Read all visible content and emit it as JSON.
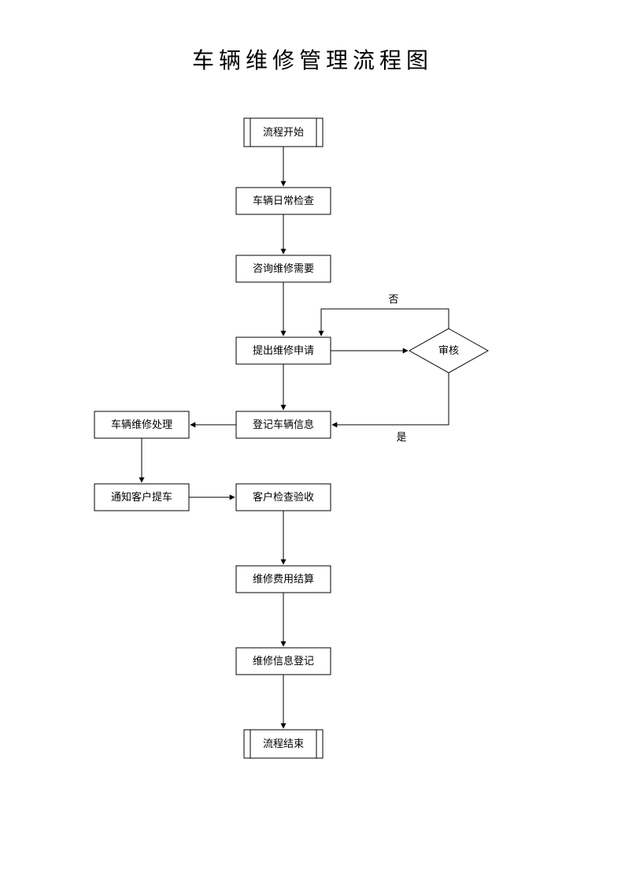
{
  "title": "车辆维修管理流程图",
  "nodes": {
    "start": {
      "label": "流程开始"
    },
    "daily_check": {
      "label": "车辆日常检查"
    },
    "consult": {
      "label": "咨询维修需要"
    },
    "apply": {
      "label": "提出维修申请"
    },
    "audit": {
      "label": "审核"
    },
    "register_info": {
      "label": "登记车辆信息"
    },
    "repair": {
      "label": "车辆维修处理"
    },
    "notify": {
      "label": "通知客户提车"
    },
    "inspect": {
      "label": "客户检查验收"
    },
    "settle": {
      "label": "维修费用结算"
    },
    "log": {
      "label": "维修信息登记"
    },
    "end": {
      "label": "流程结束"
    }
  },
  "edges": {
    "audit_no": {
      "label": "否"
    },
    "audit_yes": {
      "label": "是"
    }
  },
  "chart_data": {
    "type": "flowchart",
    "title": "车辆维修管理流程图",
    "nodes": [
      {
        "id": "start",
        "type": "terminator",
        "label": "流程开始"
      },
      {
        "id": "daily_check",
        "type": "process",
        "label": "车辆日常检查"
      },
      {
        "id": "consult",
        "type": "process",
        "label": "咨询维修需要"
      },
      {
        "id": "apply",
        "type": "process",
        "label": "提出维修申请"
      },
      {
        "id": "audit",
        "type": "decision",
        "label": "审核"
      },
      {
        "id": "register_info",
        "type": "process",
        "label": "登记车辆信息"
      },
      {
        "id": "repair",
        "type": "process",
        "label": "车辆维修处理"
      },
      {
        "id": "notify",
        "type": "process",
        "label": "通知客户提车"
      },
      {
        "id": "inspect",
        "type": "process",
        "label": "客户检查验收"
      },
      {
        "id": "settle",
        "type": "process",
        "label": "维修费用结算"
      },
      {
        "id": "log",
        "type": "process",
        "label": "维修信息登记"
      },
      {
        "id": "end",
        "type": "terminator",
        "label": "流程结束"
      }
    ],
    "edges": [
      {
        "from": "start",
        "to": "daily_check"
      },
      {
        "from": "daily_check",
        "to": "consult"
      },
      {
        "from": "consult",
        "to": "apply"
      },
      {
        "from": "apply",
        "to": "audit"
      },
      {
        "from": "audit",
        "to": "apply",
        "label": "否"
      },
      {
        "from": "audit",
        "to": "register_info",
        "label": "是"
      },
      {
        "from": "apply",
        "to": "register_info"
      },
      {
        "from": "register_info",
        "to": "repair"
      },
      {
        "from": "repair",
        "to": "notify"
      },
      {
        "from": "notify",
        "to": "inspect"
      },
      {
        "from": "inspect",
        "to": "settle"
      },
      {
        "from": "settle",
        "to": "log"
      },
      {
        "from": "log",
        "to": "end"
      }
    ]
  }
}
